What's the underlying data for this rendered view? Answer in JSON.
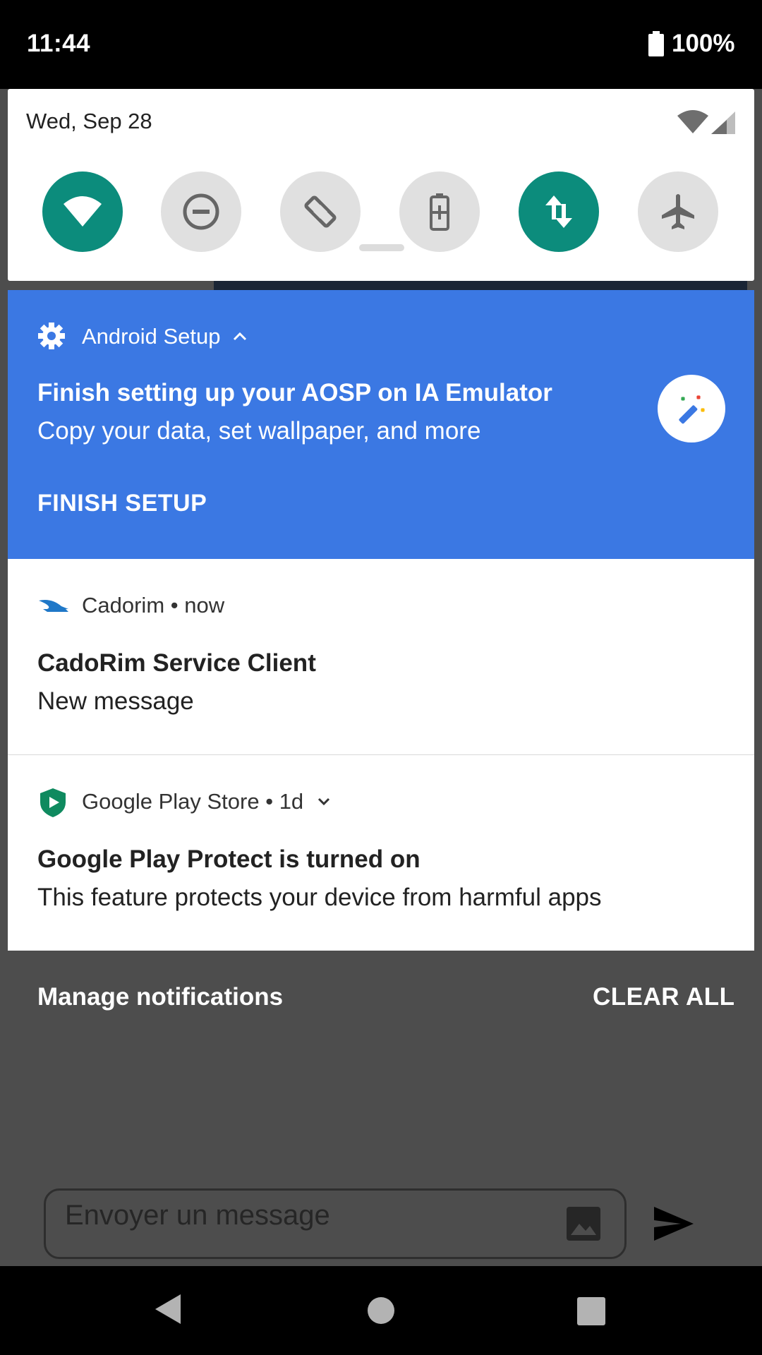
{
  "status_bar": {
    "time": "11:44",
    "battery": "100%"
  },
  "quick_settings": {
    "date": "Wed, Sep 28",
    "tiles": [
      {
        "name": "wifi",
        "icon": "wifi-icon",
        "state": "on"
      },
      {
        "name": "do-not-disturb",
        "icon": "do-not-disturb-icon",
        "state": "off"
      },
      {
        "name": "auto-rotate",
        "icon": "rotate-icon",
        "state": "off"
      },
      {
        "name": "battery-saver",
        "icon": "battery-saver-icon",
        "state": "off"
      },
      {
        "name": "mobile-data",
        "icon": "data-arrows-icon",
        "state": "on"
      },
      {
        "name": "airplane-mode",
        "icon": "airplane-icon",
        "state": "off"
      }
    ]
  },
  "notifications": {
    "setup": {
      "app": "Android Setup",
      "title": "Finish setting up your AOSP on IA Emulator",
      "text": "Copy your data, set wallpaper, and more",
      "action": "FINISH SETUP"
    },
    "cadorim": {
      "app": "Cadorim",
      "time": "now",
      "title": "CadoRim Service Client",
      "text": "New message"
    },
    "playstore": {
      "app": "Google Play Store",
      "time": "1d",
      "title": "Google Play Protect is turned on",
      "text": "This feature protects your device from harmful apps"
    }
  },
  "footer": {
    "manage": "Manage notifications",
    "clear_all": "CLEAR ALL"
  },
  "composer": {
    "placeholder": "Envoyer un message"
  },
  "colors": {
    "accent_teal": "#0c8c7c",
    "setup_blue": "#3b78e3",
    "shade": "#4d4d4d"
  }
}
